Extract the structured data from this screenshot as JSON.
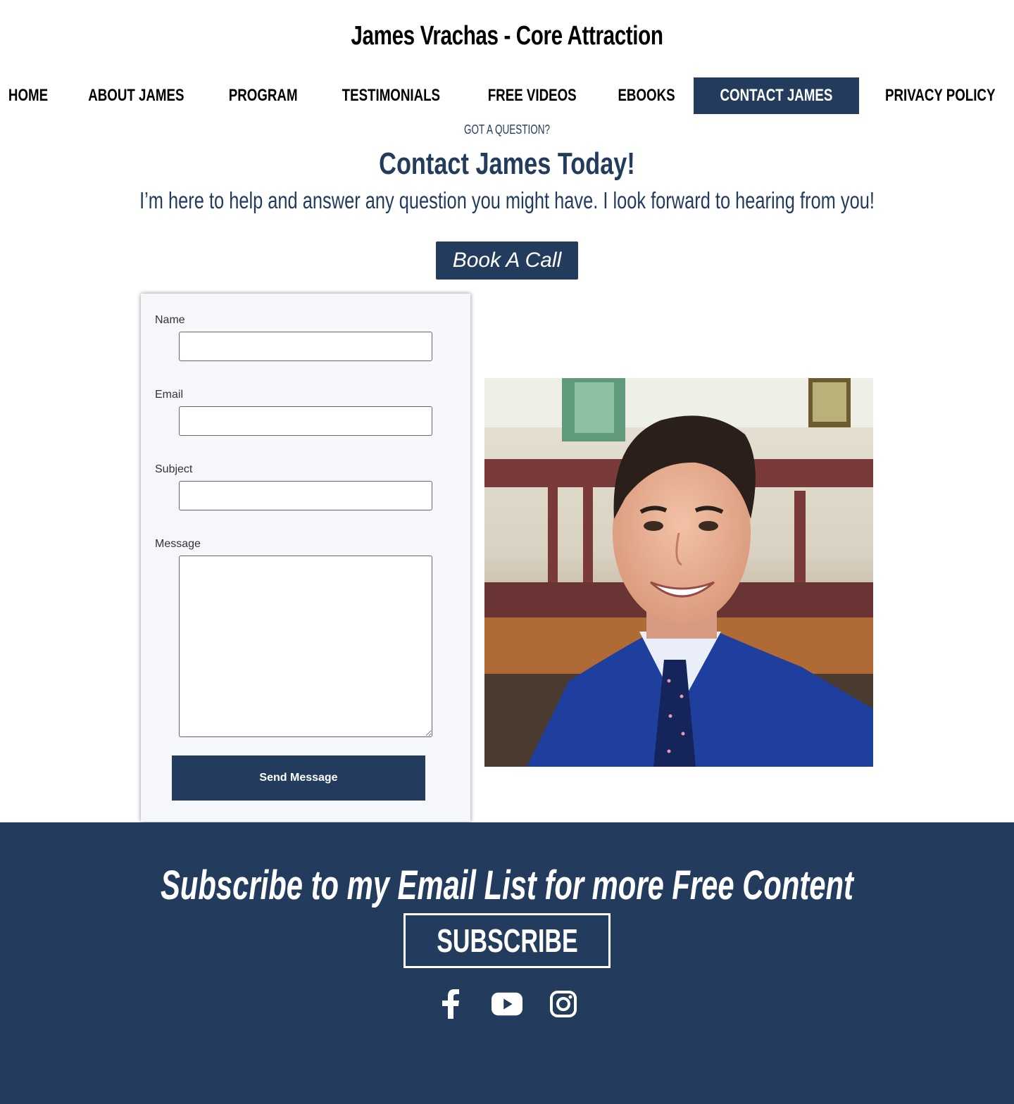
{
  "site": {
    "title": "James Vrachas - Core Attraction"
  },
  "nav": {
    "items": [
      {
        "label": "HOME",
        "active": false
      },
      {
        "label": "ABOUT JAMES",
        "active": false
      },
      {
        "label": "PROGRAM",
        "active": false
      },
      {
        "label": "TESTIMONIALS",
        "active": false
      },
      {
        "label": "FREE VIDEOS",
        "active": false
      },
      {
        "label": "EBOOKS",
        "active": false
      },
      {
        "label": "CONTACT JAMES",
        "active": true
      },
      {
        "label": "PRIVACY POLICY",
        "active": false
      }
    ]
  },
  "hero": {
    "eyebrow": "GOT A QUESTION?",
    "heading": "Contact James Today!",
    "subheading": "I’m here to help and answer any question you might have. I look forward to hearing from you!",
    "book_button": "Book A Call"
  },
  "form": {
    "name_label": "Name",
    "name_value": "",
    "email_label": "Email",
    "email_value": "",
    "subject_label": "Subject",
    "subject_value": "",
    "message_label": "Message",
    "message_value": "",
    "submit_label": "Send Message"
  },
  "footer": {
    "title": "Subscribe to my Email List for more Free Content",
    "subscribe_label": "SUBSCRIBE",
    "social": [
      "facebook-icon",
      "youtube-icon",
      "instagram-icon"
    ]
  },
  "colors": {
    "brand_navy": "#233c5e",
    "form_background": "#f5f7fb"
  }
}
